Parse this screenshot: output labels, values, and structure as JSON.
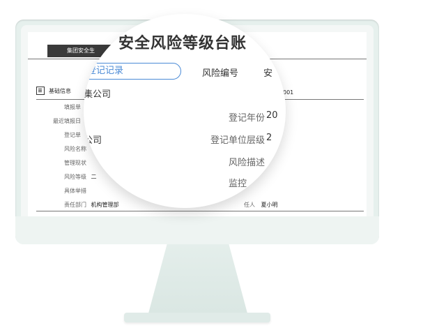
{
  "left_panel": {
    "topbar_label": "集团安全生",
    "section_title": "基础信息",
    "rows": [
      {
        "label": "填报单",
        "value": ""
      },
      {
        "label": "最近填报日",
        "value": ""
      },
      {
        "label": "登记单",
        "value": ""
      },
      {
        "label": "风险名称",
        "value": ""
      },
      {
        "label": "管理现状",
        "value": ""
      },
      {
        "label": "风险等级",
        "value": "二"
      },
      {
        "label": "具体举措",
        "value": ""
      },
      {
        "label": "责任部门",
        "value": "机构管理部"
      }
    ]
  },
  "right_panel": {
    "id_fragment": "001",
    "responsible_label": "任人",
    "responsible_value": "夏小明"
  },
  "magnifier": {
    "title": "安全风险等级台账",
    "tab_label": "登记记录",
    "header_label": "风险编号",
    "header_right_fragment": "安",
    "company_1": "集公司",
    "company_2": "公司",
    "fields": [
      {
        "label": "登记年份",
        "value": "20"
      },
      {
        "label": "登记单位层级",
        "value": "2"
      },
      {
        "label": "风险描述",
        "value": ""
      },
      {
        "label": "监控",
        "value": ""
      }
    ]
  }
}
